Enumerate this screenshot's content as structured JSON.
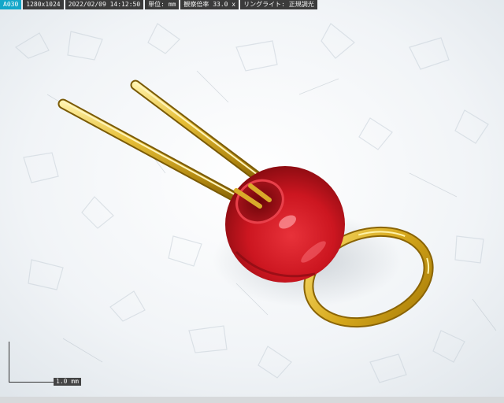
{
  "status_bar": {
    "mode": "A030",
    "resolution": "1280x1024",
    "datetime": "2022/02/09 14:12:50",
    "unit": "単位: mm",
    "magnification": "観察倍率 33.0 x",
    "illumination": "リングライト: 正規調光"
  },
  "scale_bar": {
    "label": "1.0 mm"
  },
  "colors": {
    "bead": "#d01a22",
    "gold": "#c9a227",
    "background": "#f3f5f7",
    "mode_badge": "#14a7c9"
  }
}
